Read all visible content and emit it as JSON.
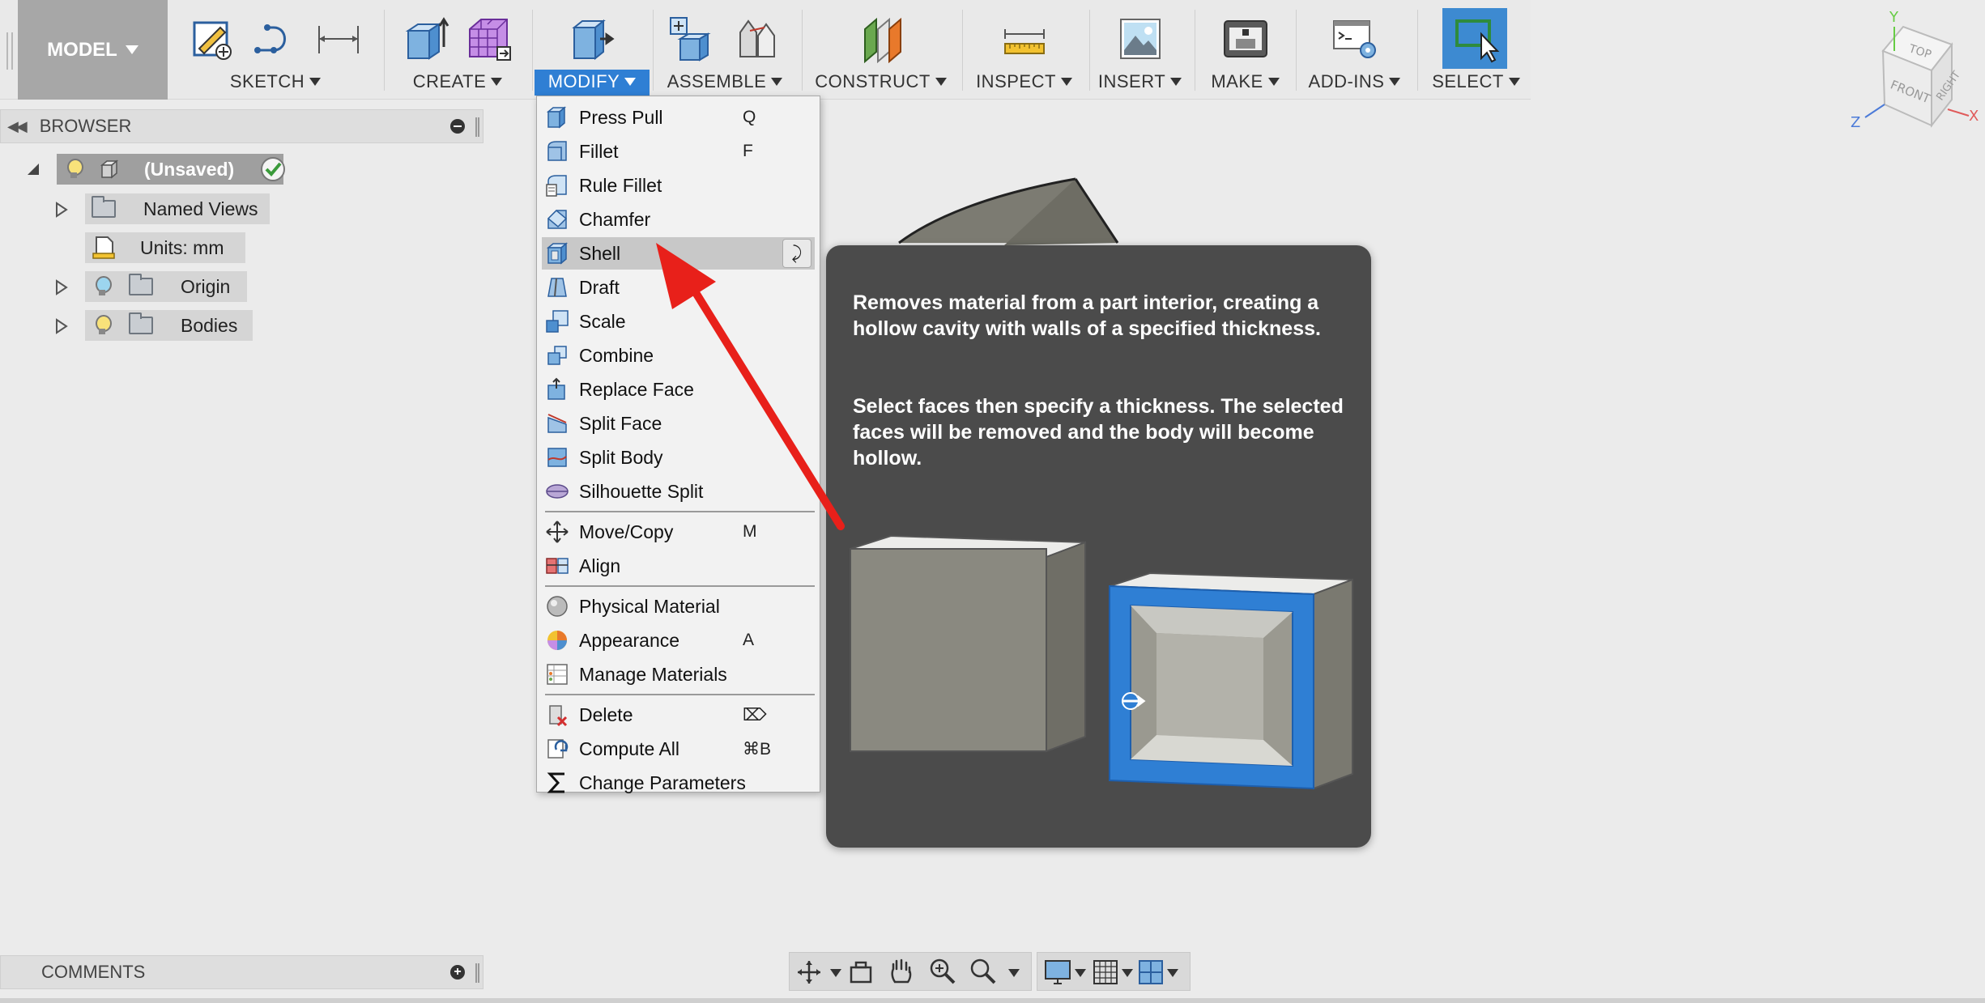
{
  "toolbar": {
    "mode_label": "MODEL",
    "groups": [
      {
        "label": "SKETCH"
      },
      {
        "label": "CREATE"
      },
      {
        "label": "MODIFY"
      },
      {
        "label": "ASSEMBLE"
      },
      {
        "label": "CONSTRUCT"
      },
      {
        "label": "INSPECT"
      },
      {
        "label": "INSERT"
      },
      {
        "label": "MAKE"
      },
      {
        "label": "ADD-INS"
      },
      {
        "label": "SELECT"
      }
    ]
  },
  "browser": {
    "title": "BROWSER",
    "root_label": "(Unsaved)",
    "items": [
      {
        "label": "Named Views"
      },
      {
        "label": "Units: mm"
      },
      {
        "label": "Origin"
      },
      {
        "label": "Bodies"
      }
    ]
  },
  "modify_menu": {
    "items": [
      {
        "label": "Press Pull",
        "shortcut": "Q"
      },
      {
        "label": "Fillet",
        "shortcut": "F"
      },
      {
        "label": "Rule Fillet",
        "shortcut": ""
      },
      {
        "label": "Chamfer",
        "shortcut": ""
      },
      {
        "label": "Shell",
        "shortcut": ""
      },
      {
        "label": "Draft",
        "shortcut": ""
      },
      {
        "label": "Scale",
        "shortcut": ""
      },
      {
        "label": "Combine",
        "shortcut": ""
      },
      {
        "label": "Replace Face",
        "shortcut": ""
      },
      {
        "label": "Split Face",
        "shortcut": ""
      },
      {
        "label": "Split Body",
        "shortcut": ""
      },
      {
        "label": "Silhouette Split",
        "shortcut": ""
      },
      {
        "label": "Move/Copy",
        "shortcut": "M"
      },
      {
        "label": "Align",
        "shortcut": ""
      },
      {
        "label": "Physical Material",
        "shortcut": ""
      },
      {
        "label": "Appearance",
        "shortcut": "A"
      },
      {
        "label": "Manage Materials",
        "shortcut": ""
      },
      {
        "label": "Delete",
        "shortcut": "⌦"
      },
      {
        "label": "Compute All",
        "shortcut": "⌘B"
      },
      {
        "label": "Change Parameters",
        "shortcut": ""
      }
    ]
  },
  "tooltip": {
    "paragraph1": "Removes material from a part interior, creating a hollow cavity with walls of a specified thickness.",
    "paragraph2": "Select faces then specify a thickness. The selected faces will be removed and the body will become hollow."
  },
  "comments": {
    "title": "COMMENTS"
  },
  "viewcube": {
    "top": "TOP",
    "front": "FRONT",
    "right": "RIGHT",
    "axis_x": "X",
    "axis_y": "Y",
    "axis_z": "Z"
  },
  "colors": {
    "accent": "#2f7fd4",
    "annotation_arrow": "#e8201a",
    "tooltip_bg": "#4b4b4b"
  }
}
